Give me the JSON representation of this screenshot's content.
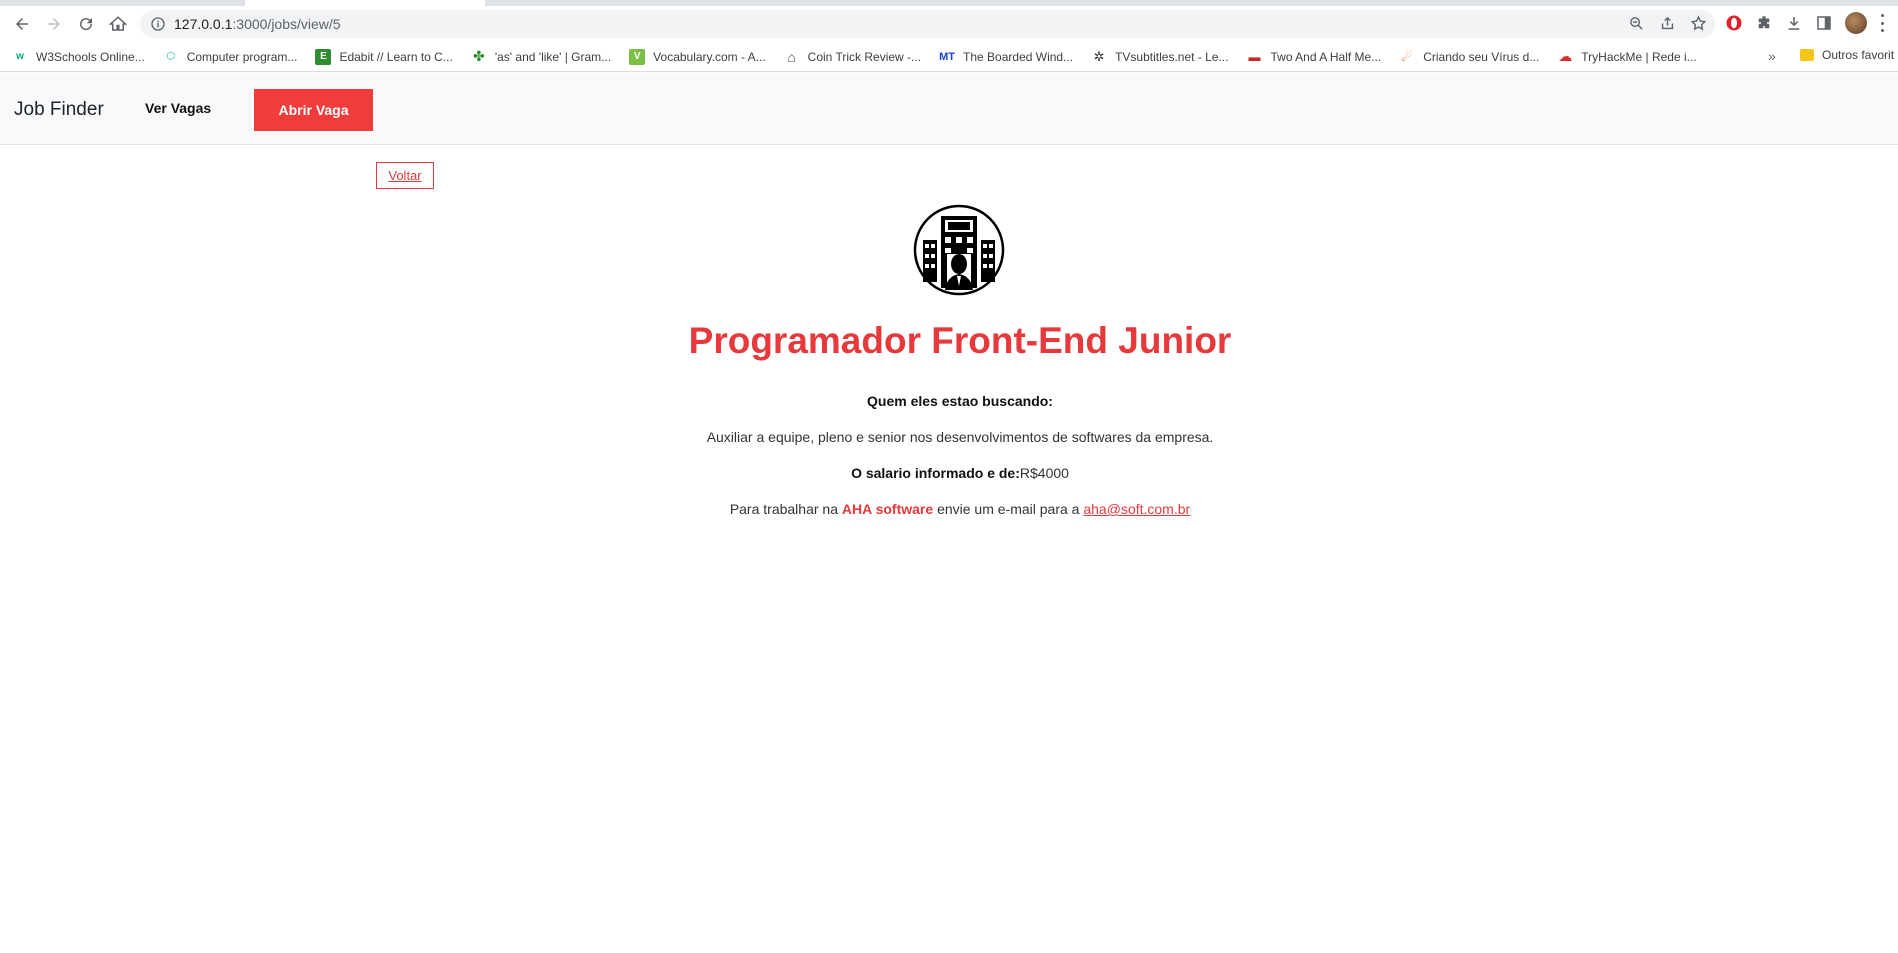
{
  "browser": {
    "url_host": "127.0.0.1",
    "url_rest": ":3000/jobs/view/5"
  },
  "bookmarks": [
    {
      "label": "W3Schools Online...",
      "icon": "w3schools-icon",
      "color": "#04aa6d",
      "glyph": "w"
    },
    {
      "label": "Computer program...",
      "icon": "hexagon-icon",
      "color": "#1fb6a8",
      "glyph": "⬡"
    },
    {
      "label": "Edabit // Learn to C...",
      "icon": "edabit-icon",
      "color": "#2e8b2e",
      "glyph": "E"
    },
    {
      "label": "'as' and 'like' | Gram...",
      "icon": "clover-icon",
      "color": "#2e8b2e",
      "glyph": "✤"
    },
    {
      "label": "Vocabulary.com - A...",
      "icon": "vocabulary-icon",
      "color": "#7ac143",
      "glyph": "V"
    },
    {
      "label": "Coin Trick Review -...",
      "icon": "house-icon",
      "color": "#4a4a4a",
      "glyph": "⌂"
    },
    {
      "label": "The Boarded Wind...",
      "icon": "mt-icon",
      "color": "#1a3fd1",
      "glyph": "MT"
    },
    {
      "label": "TVsubtitles.net - Le...",
      "icon": "film-reel-icon",
      "color": "#333333",
      "glyph": "✲"
    },
    {
      "label": "Two And A Half Me...",
      "icon": "tv-logo-icon",
      "color": "#c62828",
      "glyph": "▬"
    },
    {
      "label": "Criando seu Vírus d...",
      "icon": "shrimp-icon",
      "color": "#e64a19",
      "glyph": "☄"
    },
    {
      "label": "TryHackMe | Rede i...",
      "icon": "cloud-icon",
      "color": "#d32f2f",
      "glyph": "☁"
    }
  ],
  "bookmarks_more": "»",
  "bookmarks_folder": "Outros favorit",
  "app": {
    "brand": "Job Finder",
    "nav_link": "Ver Vagas",
    "open_button": "Abrir Vaga"
  },
  "job": {
    "back": "Voltar",
    "title": "Programador Front-End Junior",
    "search_label": "Quem eles estao buscando:",
    "description": "Auxiliar a equipe, pleno e senior nos desenvolvimentos de softwares da empresa.",
    "salary_label": "O salario informado e de:",
    "salary_value": "R$4000",
    "contact_prefix": "Para trabalhar na",
    "company": "AHA software",
    "contact_middle": "envie um e-mail para a",
    "email": "aha@soft.com.br"
  },
  "colors": {
    "accent": "#e7393c",
    "button_bg": "#f23c3c",
    "nav_bg": "#f8f9fa"
  }
}
